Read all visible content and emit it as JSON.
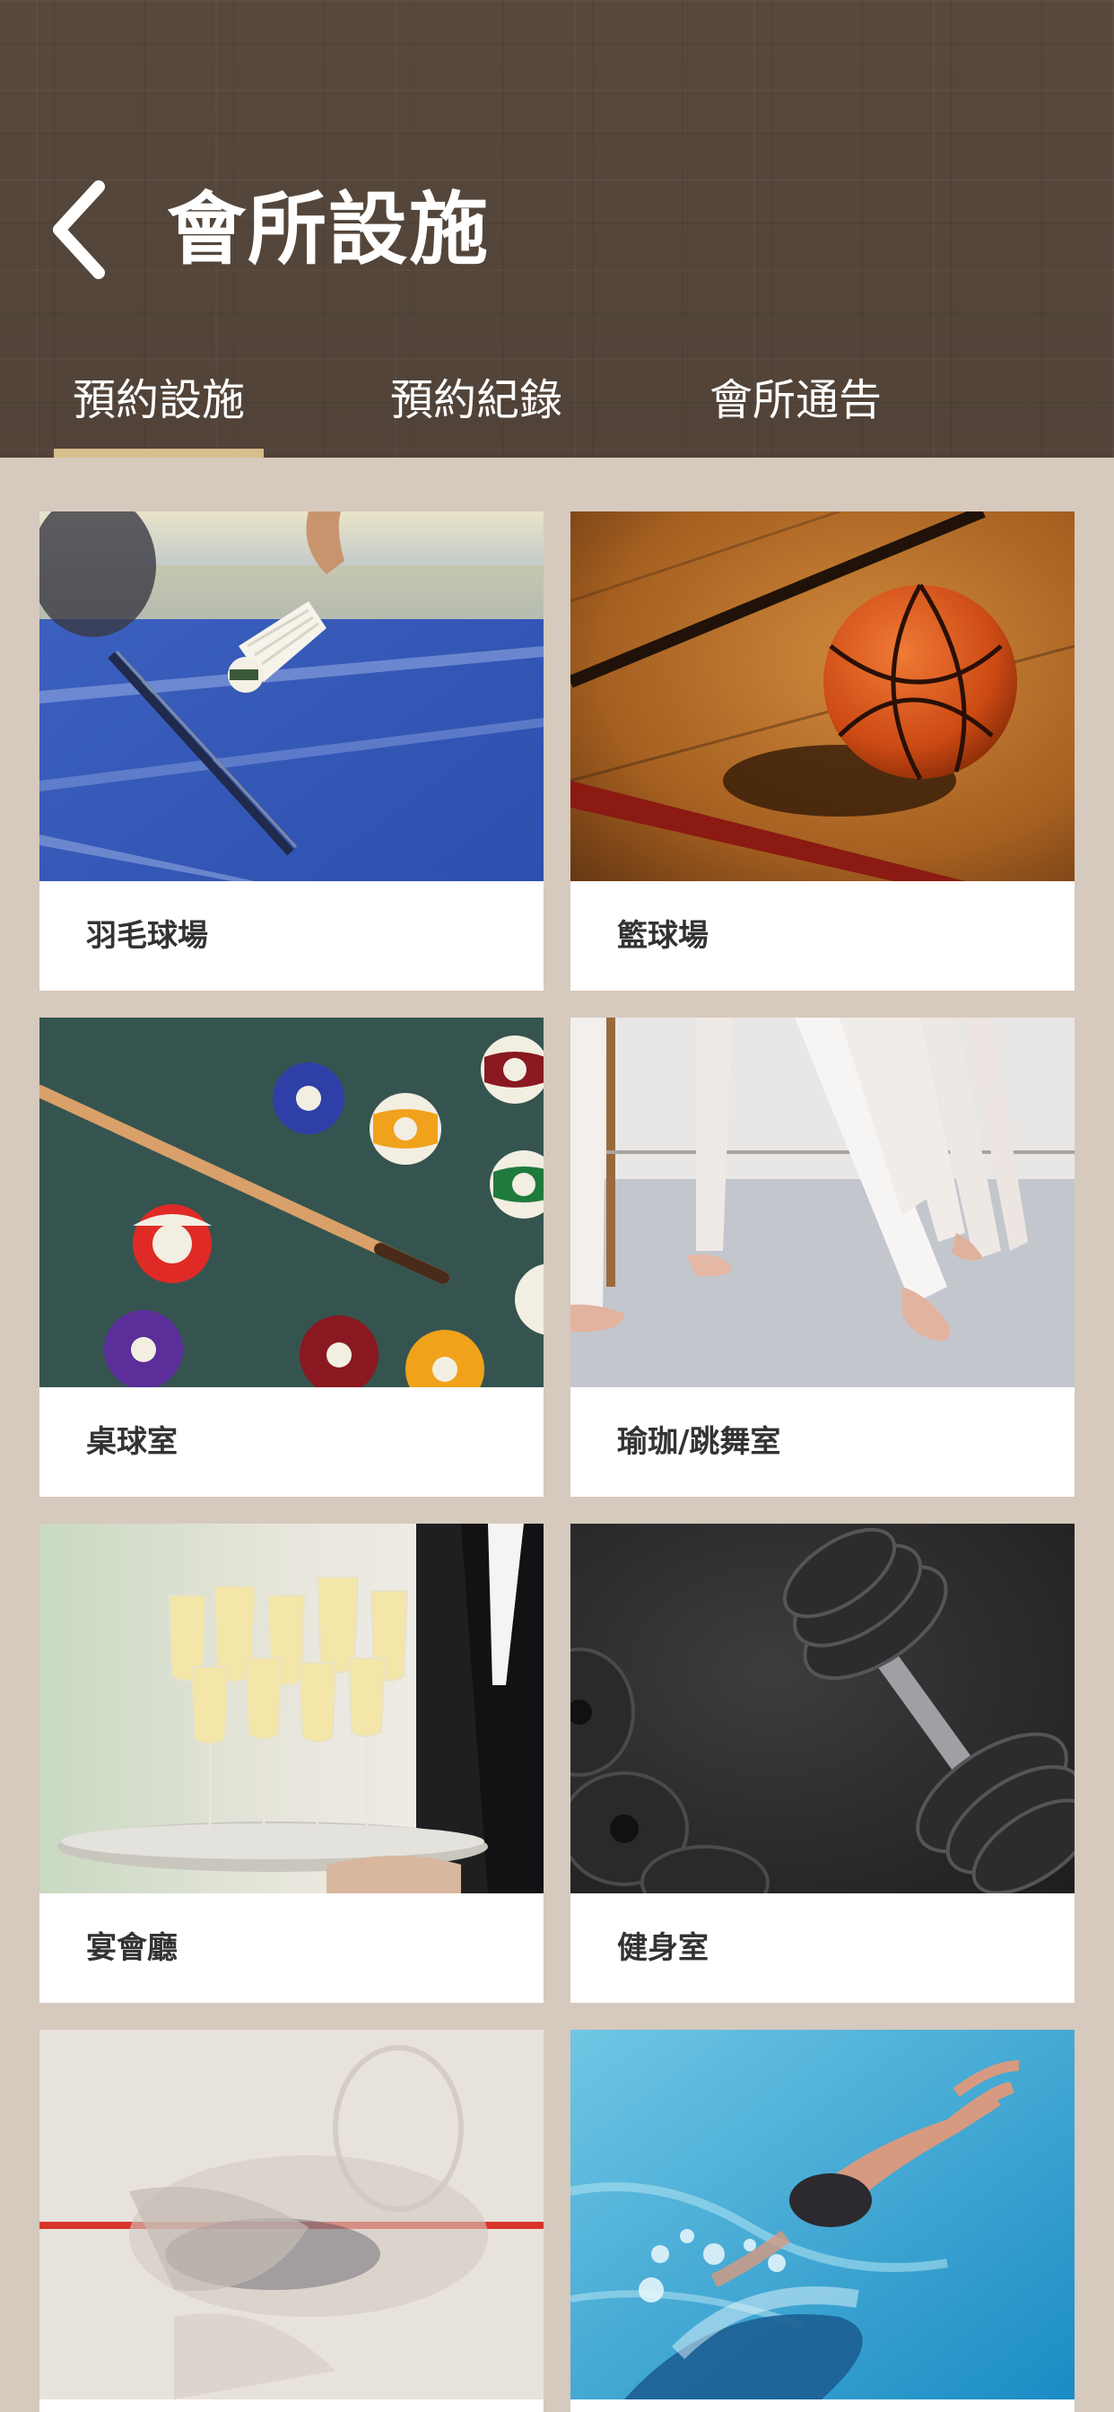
{
  "header": {
    "title": "會所設施",
    "back_icon": "chevron-left-icon"
  },
  "tabs": [
    {
      "label": "預約設施",
      "active": true
    },
    {
      "label": "預約紀錄",
      "active": false
    },
    {
      "label": "會所通告",
      "active": false
    }
  ],
  "facilities": [
    {
      "label": "羽毛球場",
      "image": "badminton-photo"
    },
    {
      "label": "籃球場",
      "image": "basketball-photo"
    },
    {
      "label": "桌球室",
      "image": "billiards-photo"
    },
    {
      "label": "瑜珈/跳舞室",
      "image": "ballet-photo"
    },
    {
      "label": "宴會廳",
      "image": "champagne-photo"
    },
    {
      "label": "健身室",
      "image": "dumbbell-photo"
    },
    {
      "label": "",
      "image": "squash-photo"
    },
    {
      "label": "",
      "image": "swimming-photo"
    }
  ],
  "colors": {
    "header_bg": "#5c4c40",
    "page_bg": "#d6c9bd",
    "tab_active_underline": "#d8be8c",
    "card_bg": "#ffffff",
    "label_text": "#333333"
  }
}
